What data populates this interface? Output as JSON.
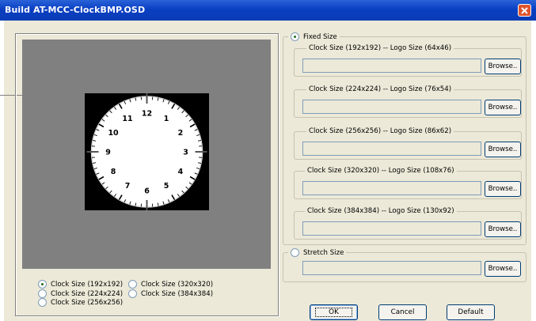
{
  "window": {
    "title": "Build AT-MCC-ClockBMP.OSD"
  },
  "clock": {
    "numerals": [
      "12",
      "1",
      "2",
      "3",
      "4",
      "5",
      "6",
      "7",
      "8",
      "9",
      "10",
      "11"
    ]
  },
  "preview_sizes": [
    {
      "label": "Clock Size (192x192)",
      "selected": true
    },
    {
      "label": "Clock Size (224x224)",
      "selected": false
    },
    {
      "label": "Clock Size (256x256)",
      "selected": false
    },
    {
      "label": "Clock Size (320x320)",
      "selected": false
    },
    {
      "label": "Clock Size (384x384)",
      "selected": false
    }
  ],
  "mode": {
    "fixed_label": "Fixed Size",
    "stretch_label": "Stretch Size",
    "selected": "fixed"
  },
  "fixed_groups": [
    {
      "label": "Clock Size (192x192) -- Logo Size (64x46)",
      "path": "",
      "browse": "Browse.."
    },
    {
      "label": "Clock Size (224x224) -- Logo Size (76x54)",
      "path": "",
      "browse": "Browse.."
    },
    {
      "label": "Clock Size (256x256) -- Logo Size (86x62)",
      "path": "",
      "browse": "Browse.."
    },
    {
      "label": "Clock Size (320x320) -- Logo Size (108x76)",
      "path": "",
      "browse": "Browse.."
    },
    {
      "label": "Clock Size (384x384) -- Logo Size (130x92)",
      "path": "",
      "browse": "Browse.."
    }
  ],
  "stretch": {
    "path": "",
    "browse": "Browse.."
  },
  "buttons": {
    "ok": "OK",
    "cancel": "Cancel",
    "default": "Default"
  }
}
